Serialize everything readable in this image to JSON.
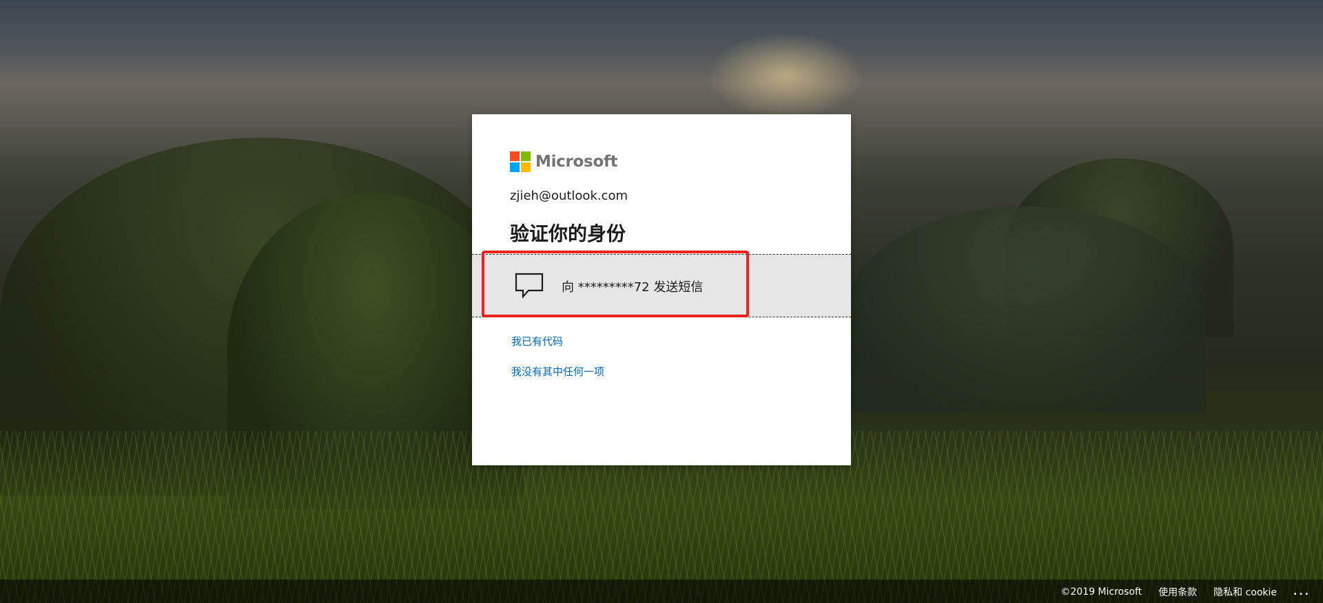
{
  "brand": {
    "name": "Microsoft",
    "logo_colors": [
      "#f25022",
      "#7fba00",
      "#00a4ef",
      "#ffb900"
    ]
  },
  "account": "zjieh@outlook.com",
  "title": "验证你的身份",
  "options": [
    {
      "icon": "chat-bubble-icon",
      "label": "向 *********72 发送短信"
    }
  ],
  "links": {
    "have_code": "我已有代码",
    "none_of_these": "我没有其中任何一项"
  },
  "footer": {
    "copyright": "©2019 Microsoft",
    "terms": "使用条款",
    "privacy": "隐私和 cookie",
    "more": "..."
  },
  "colors": {
    "link": "#0067b8",
    "highlight": "#e8231c",
    "option_bg": "#e6e6e6"
  }
}
